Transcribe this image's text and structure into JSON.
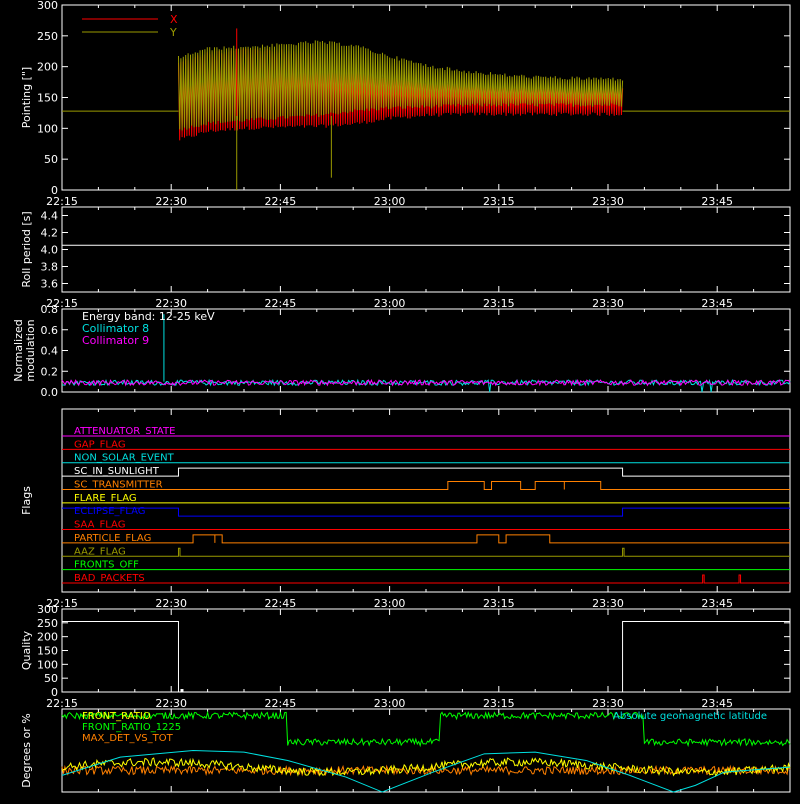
{
  "chart_data": {
    "time_ticks": [
      "22:15",
      "22:30",
      "22:45",
      "23:00",
      "23:15",
      "23:30",
      "23:45"
    ],
    "time_range": [
      "22:15",
      "23:55"
    ],
    "panels": [
      {
        "id": "pointing",
        "type": "line",
        "ylabel": "Pointing [\"]",
        "ylim": [
          0,
          300
        ],
        "yticks": [
          "0",
          "50",
          "100",
          "150",
          "200",
          "250",
          "300"
        ],
        "legend": [
          {
            "label": "X",
            "color": "#ff0000"
          },
          {
            "label": "Y",
            "color": "#9a9a00"
          }
        ],
        "data_window": [
          "22:31",
          "23:32"
        ],
        "baseline": 128,
        "series": [
          {
            "name": "X",
            "color": "#ff0000",
            "x": [
              "22:31",
              "22:35",
              "22:40",
              "22:45",
              "22:50",
              "22:55",
              "23:00",
              "23:05",
              "23:10",
              "23:15",
              "23:20",
              "23:25",
              "23:32"
            ],
            "lower": [
              78,
              92,
              97,
              99,
              100,
              104,
              113,
              118,
              120,
              120,
              120,
              120,
              120
            ],
            "upper": [
              210,
              225,
              232,
              228,
              222,
              198,
              185,
              178,
              175,
              172,
              171,
              170,
              170
            ]
          },
          {
            "name": "Y",
            "color": "#9a9a00",
            "x": [
              "22:31",
              "22:35",
              "22:40",
              "22:45",
              "22:50",
              "22:55",
              "23:00",
              "23:05",
              "23:10",
              "23:15",
              "23:20",
              "23:25",
              "23:32"
            ],
            "lower": [
              95,
              105,
              110,
              114,
              118,
              125,
              130,
              132,
              134,
              135,
              135,
              135,
              135
            ],
            "upper": [
              218,
              232,
              235,
              238,
              243,
              238,
              220,
              205,
              196,
              190,
              186,
              184,
              183
            ]
          }
        ]
      },
      {
        "id": "roll",
        "type": "line",
        "ylabel": "Roll period [s]",
        "ylim": [
          3.5,
          4.5
        ],
        "yticks": [
          "3.6",
          "3.8",
          "4.0",
          "4.2",
          "4.4"
        ],
        "series": [
          {
            "name": "Roll period",
            "color": "#ffffff",
            "value": 4.05
          }
        ]
      },
      {
        "id": "modulation",
        "type": "line",
        "ylabel": [
          "Normalized",
          "modulation"
        ],
        "ylim": [
          0,
          0.8
        ],
        "yticks": [
          "0.0",
          "0.2",
          "0.4",
          "0.6",
          "0.8"
        ],
        "legend": [
          {
            "label": "Energy band: 12-25 keV",
            "color": "#ffffff"
          },
          {
            "label": "Collimator 8",
            "color": "#00e0e0"
          },
          {
            "label": "Collimator 9",
            "color": "#ff00ff"
          }
        ],
        "series": [
          {
            "name": "Collimator 8",
            "color": "#00e0e0",
            "typical": 0.09,
            "spike": {
              "x": "22:29",
              "y": 0.75
            }
          },
          {
            "name": "Collimator 9",
            "color": "#ff00ff",
            "typical": 0.09
          }
        ]
      },
      {
        "id": "flags",
        "type": "line",
        "ylabel": "Flags",
        "flags": [
          {
            "name": "ATTENUATOR_STATE",
            "color": "#ff00ff",
            "on": []
          },
          {
            "name": "GAP_FLAG",
            "color": "#ff0000",
            "on": []
          },
          {
            "name": "NON_SOLAR_EVENT",
            "color": "#00e0e0",
            "on": []
          },
          {
            "name": "SC_IN_SUNLIGHT",
            "color": "#ffffff",
            "on": [
              [
                "22:31",
                "23:32"
              ]
            ]
          },
          {
            "name": "SC_TRANSMITTER",
            "color": "#ff8000",
            "on": [
              [
                "23:08",
                "23:13"
              ],
              [
                "23:14",
                "23:18"
              ],
              [
                "23:20",
                "23:24"
              ],
              [
                "23:24",
                "23:29"
              ]
            ]
          },
          {
            "name": "FLARE_FLAG",
            "color": "#ffff00",
            "on": []
          },
          {
            "name": "ECLIPSE_FLAG",
            "color": "#0000ff",
            "inverse": true,
            "off": [
              [
                "22:31",
                "23:32"
              ]
            ]
          },
          {
            "name": "SAA_FLAG",
            "color": "#ff0000",
            "on": []
          },
          {
            "name": "PARTICLE_FLAG",
            "color": "#ff8000",
            "on": [
              [
                "22:33",
                "22:36"
              ],
              [
                "22:36",
                "22:37"
              ],
              [
                "23:12",
                "23:15"
              ],
              [
                "23:16",
                "23:22"
              ]
            ]
          },
          {
            "name": "AAZ_FLAG",
            "color": "#9a9a00",
            "on": [
              [
                "22:31",
                "22:31"
              ],
              [
                "23:32",
                "23:32"
              ]
            ]
          },
          {
            "name": "FRONTS_OFF",
            "color": "#00ff00",
            "on": []
          },
          {
            "name": "BAD_PACKETS",
            "color": "#ff0000",
            "on": [
              [
                "23:43",
                "23:43"
              ],
              [
                "23:48",
                "23:48"
              ]
            ]
          }
        ]
      },
      {
        "id": "quality",
        "type": "line",
        "ylabel": "Quality",
        "ylim": [
          0,
          300
        ],
        "yticks": [
          "0",
          "50",
          "100",
          "150",
          "200",
          "250",
          "300"
        ],
        "series": [
          {
            "name": "Quality",
            "color": "#ffffff",
            "x": [
              "22:15",
              "22:31",
              "22:31",
              "23:32",
              "23:32",
              "23:55"
            ],
            "y": [
              255,
              255,
              0,
              0,
              255,
              255
            ]
          }
        ]
      },
      {
        "id": "ratios",
        "type": "line",
        "ylabel": "Degrees or %",
        "ylim": [
          0,
          100
        ],
        "legend": [
          {
            "label": "FRONT_RATIO",
            "color": "#ffff00"
          },
          {
            "label": "FRONT_RATIO_1225",
            "color": "#00ff00"
          },
          {
            "label": "MAX_DET_VS_TOT",
            "color": "#ff8000"
          }
        ],
        "legend_right": {
          "label": "Absolute geomagnetic latitude",
          "color": "#00e0e0"
        },
        "series": [
          {
            "name": "FRONT_RATIO_1225",
            "color": "#00ff00",
            "x": [
              "22:15",
              "22:46",
              "22:46",
              "23:07",
              "23:07",
              "23:35",
              "23:35",
              "23:55"
            ],
            "y": [
              92,
              92,
              60,
              60,
              92,
              92,
              60,
              60
            ]
          },
          {
            "name": "FRONT_RATIO",
            "color": "#ffff00",
            "typical": 30
          },
          {
            "name": "MAX_DET_VS_TOT",
            "color": "#ff8000",
            "typical": 26
          },
          {
            "name": "Absolute geomagnetic latitude",
            "color": "#00e0e0",
            "x": [
              "22:15",
              "22:23",
              "22:33",
              "22:40",
              "22:46",
              "22:54",
              "22:59",
              "23:06",
              "23:13",
              "23:20",
              "23:27",
              "23:33",
              "23:39",
              "23:42",
              "23:46",
              "23:55"
            ],
            "y": [
              20,
              42,
              50,
              48,
              38,
              18,
              0,
              24,
              46,
              48,
              38,
              20,
              0,
              8,
              24,
              30
            ]
          }
        ]
      }
    ]
  }
}
